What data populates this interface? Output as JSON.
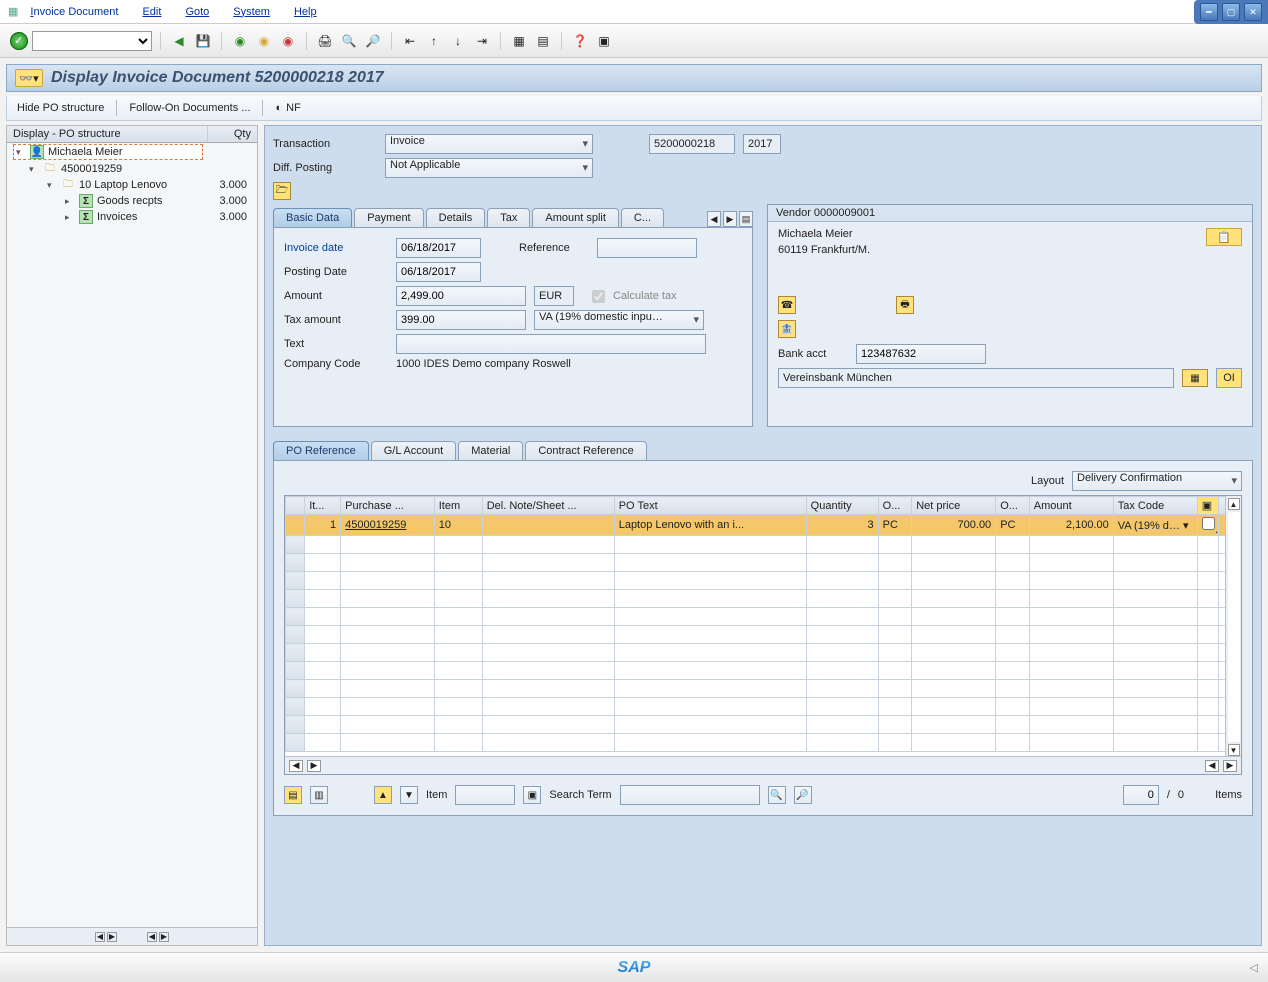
{
  "menu": {
    "items": [
      "Invoice Document",
      "Edit",
      "Goto",
      "System",
      "Help"
    ]
  },
  "page": {
    "title": "Display Invoice Document 5200000218 2017"
  },
  "subtoolbar": {
    "hide_po": "Hide PO structure",
    "follow_on": "Follow-On Documents ...",
    "nf": "NF"
  },
  "tree": {
    "header_label": "Display - PO structure",
    "header_qty": "Qty",
    "rows": [
      {
        "level": 0,
        "exp": "▾",
        "icon": "person",
        "label": "Michaela Meier",
        "qty": ""
      },
      {
        "level": 1,
        "exp": "▾",
        "icon": "folder",
        "label": "4500019259",
        "qty": ""
      },
      {
        "level": 2,
        "exp": "▾",
        "icon": "folder",
        "label": "10 Laptop Lenovo",
        "qty": "3.000"
      },
      {
        "level": 3,
        "exp": "▸",
        "icon": "sigma",
        "label": "Goods recpts",
        "qty": "3.000"
      },
      {
        "level": 3,
        "exp": "▸",
        "icon": "sigma",
        "label": "Invoices",
        "qty": "3.000"
      }
    ]
  },
  "header_form": {
    "transaction_label": "Transaction",
    "transaction_value": "Invoice",
    "doc_no": "5200000218",
    "year": "2017",
    "diff_posting_label": "Diff. Posting",
    "diff_posting_value": "Not Applicable"
  },
  "tabs_top": [
    "Basic Data",
    "Payment",
    "Details",
    "Tax",
    "Amount split",
    "C..."
  ],
  "basic": {
    "invoice_date_label": "Invoice date",
    "invoice_date": "06/18/2017",
    "reference_label": "Reference",
    "reference": "",
    "posting_date_label": "Posting Date",
    "posting_date": "06/18/2017",
    "amount_label": "Amount",
    "amount": "2,499.00",
    "currency": "EUR",
    "calc_tax_label": "Calculate tax",
    "tax_amount_label": "Tax amount",
    "tax_amount": "399.00",
    "tax_code": "VA (19% domestic inpu…",
    "text_label": "Text",
    "text": "",
    "company_code_label": "Company Code",
    "company_code": "1000 IDES Demo company Roswell"
  },
  "vendor": {
    "title": "Vendor 0000009001",
    "name": "Michaela Meier",
    "city": "60119 Frankfurt/M.",
    "bank_label": "Bank acct",
    "bank_acct": "123487632",
    "bank_name": "Vereinsbank München",
    "oi": "OI"
  },
  "tabs_lower": [
    "PO Reference",
    "G/L Account",
    "Material",
    "Contract Reference"
  ],
  "layout": {
    "label": "Layout",
    "value": "Delivery Confirmation"
  },
  "grid": {
    "cols": [
      "It...",
      "Purchase ...",
      "Item",
      "Del. Note/Sheet ...",
      "PO Text",
      "Quantity",
      "O...",
      "Net price",
      "O...",
      "Amount",
      "Tax Code"
    ],
    "row": {
      "it": "1",
      "po": "4500019259",
      "item": "10",
      "del": "",
      "text": "Laptop Lenovo with an i...",
      "qty": "3",
      "ou1": "PC",
      "price": "700.00",
      "ou2": "PC",
      "amount": "2,100.00",
      "tax": "VA (19% d…"
    }
  },
  "item_bar": {
    "item_label": "Item",
    "item_value": "",
    "search_label": "Search Term",
    "search_value": "",
    "count_val": "0",
    "count_sep": "/",
    "count_total": "0",
    "items_label": "Items"
  }
}
